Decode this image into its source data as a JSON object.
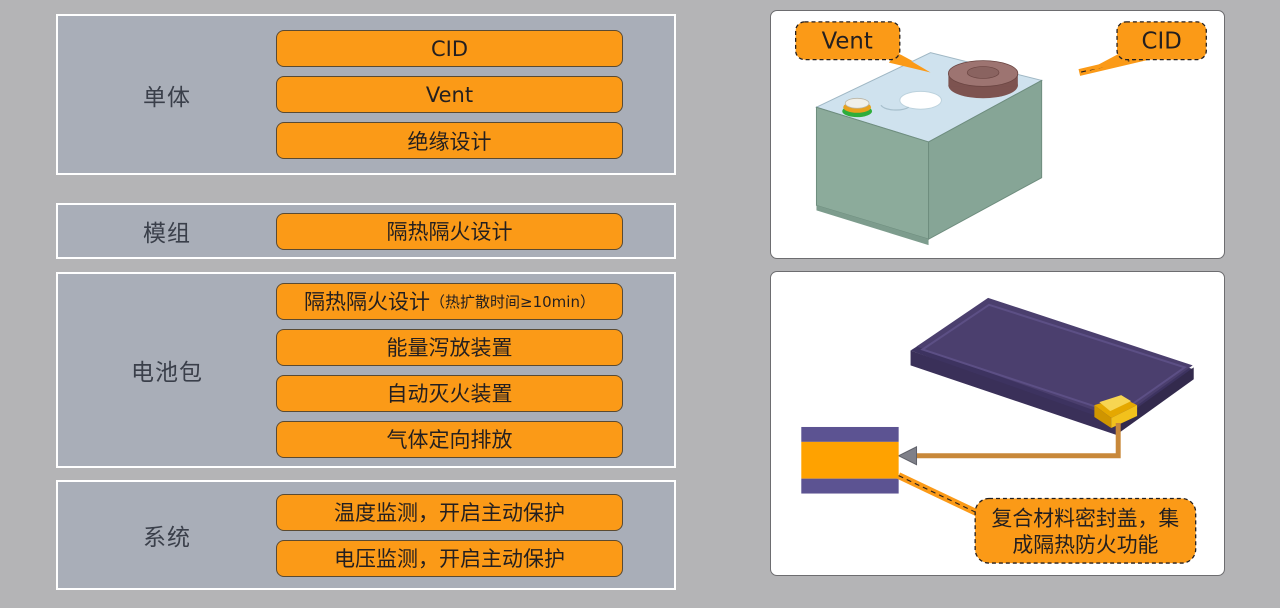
{
  "left_table": {
    "rows": [
      {
        "category": "单体",
        "items": [
          {
            "text": "CID",
            "note": ""
          },
          {
            "text": "Vent",
            "note": ""
          },
          {
            "text": "绝缘设计",
            "note": ""
          }
        ]
      },
      {
        "category": "模组",
        "items": [
          {
            "text": "隔热隔火设计",
            "note": ""
          }
        ]
      },
      {
        "category": "电池包",
        "items": [
          {
            "text": "隔热隔火设计",
            "note": "（热扩散时间≥10min）"
          },
          {
            "text": "能量泻放装置",
            "note": ""
          },
          {
            "text": "自动灭火装置",
            "note": ""
          },
          {
            "text": "气体定向排放",
            "note": ""
          }
        ]
      },
      {
        "category": "系统",
        "items": [
          {
            "text": "温度监测，开启主动保护",
            "note": ""
          },
          {
            "text": "电压监测，开启主动保护",
            "note": ""
          }
        ]
      }
    ]
  },
  "cell_card": {
    "callouts": [
      {
        "label": "Vent"
      },
      {
        "label": "CID"
      }
    ]
  },
  "pouch_card": {
    "callouts": [
      {
        "label_line1": "复合材料密封盖，集",
        "label_line2": "成隔热防火功能"
      }
    ]
  },
  "colors": {
    "page_background": "#b4b4b6",
    "panel_background": "#a9aeb8",
    "panel_border": "#ffffff",
    "pill_fill": "#fb9a17",
    "pill_border": "#5a4a32",
    "label_text": "#3a3f4a",
    "card_background": "#ffffff",
    "card_border": "#6d6d70",
    "cell_body": "#8cab9b",
    "cell_top": "#cfe2ee",
    "cid_cap": "#8e5f5c",
    "pouch_body": "#4b3f6e",
    "pouch_tab": "#f2c11c",
    "layer_purple": "#5c5392",
    "layer_orange": "#ffa200"
  }
}
